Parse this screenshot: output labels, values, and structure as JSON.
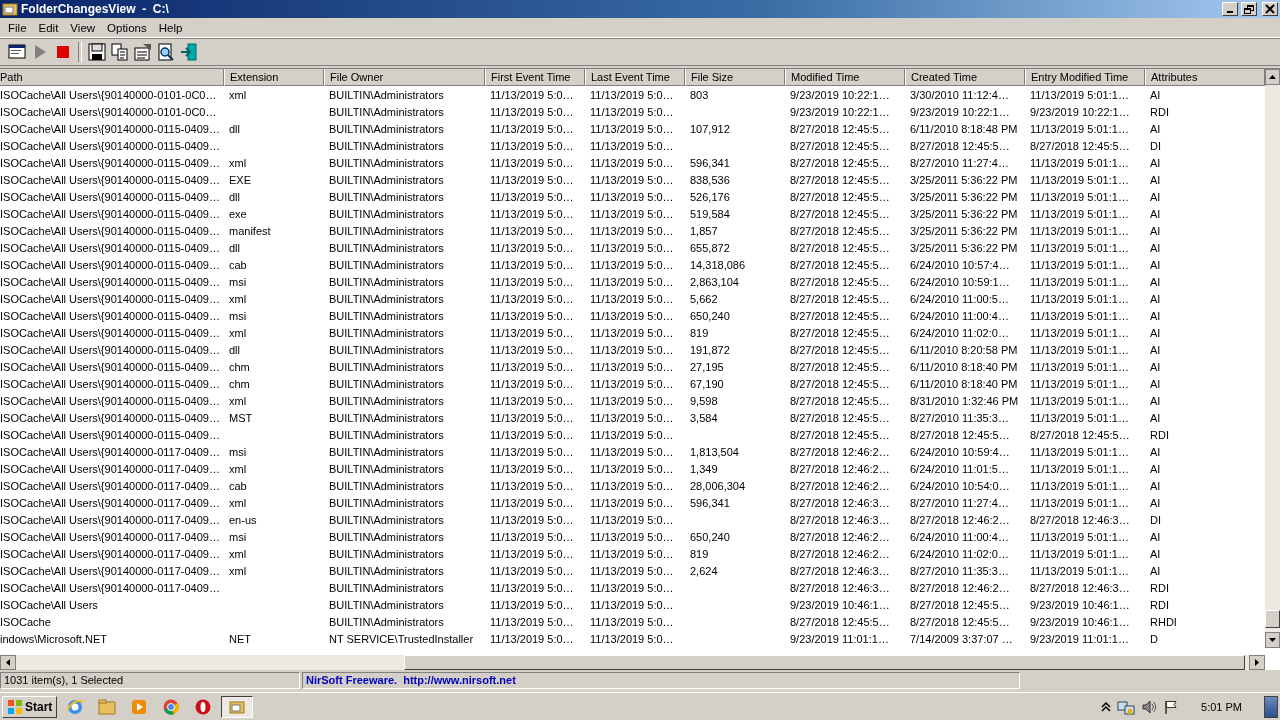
{
  "window": {
    "title": "FolderChangesView  -  C:\\"
  },
  "menu": [
    "File",
    "Edit",
    "View",
    "Options",
    "Help"
  ],
  "table": {
    "columns": [
      "Path",
      "Extension",
      "File Owner",
      "First Event Time",
      "Last Event Time",
      "File Size",
      "Modified Time",
      "Created Time",
      "Entry Modified Time",
      "Attributes"
    ],
    "rows": [
      {
        "path": "ISOCache\\All Users\\{90140000-0101-0C0…",
        "extension": "xml",
        "file_owner": "BUILTIN\\Administrators",
        "first_event_time": "11/13/2019 5:0…",
        "last_event_time": "11/13/2019 5:0…",
        "file_size": "803",
        "modified_time": "9/23/2019 10:22:1…",
        "created_time": "3/30/2010 11:12:4…",
        "entry_modified_time": "11/13/2019 5:01:1…",
        "attributes": "AI"
      },
      {
        "path": "ISOCache\\All Users\\{90140000-0101-0C0…",
        "file_owner": "BUILTIN\\Administrators",
        "first_event_time": "11/13/2019 5:0…",
        "last_event_time": "11/13/2019 5:0…",
        "modified_time": "9/23/2019 10:22:1…",
        "created_time": "9/23/2019 10:22:1…",
        "entry_modified_time": "9/23/2019 10:22:1…",
        "attributes": "RDI"
      },
      {
        "path": "ISOCache\\All Users\\{90140000-0115-0409…",
        "extension": "dll",
        "file_owner": "BUILTIN\\Administrators",
        "first_event_time": "11/13/2019 5:0…",
        "last_event_time": "11/13/2019 5:0…",
        "file_size": "107,912",
        "modified_time": "8/27/2018 12:45:5…",
        "created_time": "6/11/2010 8:18:48 PM",
        "entry_modified_time": "11/13/2019 5:01:1…",
        "attributes": "AI"
      },
      {
        "path": "ISOCache\\All Users\\{90140000-0115-0409…",
        "file_owner": "BUILTIN\\Administrators",
        "first_event_time": "11/13/2019 5:0…",
        "last_event_time": "11/13/2019 5:0…",
        "modified_time": "8/27/2018 12:45:5…",
        "created_time": "8/27/2018 12:45:5…",
        "entry_modified_time": "8/27/2018 12:45:5…",
        "attributes": "DI"
      },
      {
        "path": "ISOCache\\All Users\\{90140000-0115-0409…",
        "extension": "xml",
        "file_owner": "BUILTIN\\Administrators",
        "first_event_time": "11/13/2019 5:0…",
        "last_event_time": "11/13/2019 5:0…",
        "file_size": "596,341",
        "modified_time": "8/27/2018 12:45:5…",
        "created_time": "8/27/2010 11:27:4…",
        "entry_modified_time": "11/13/2019 5:01:1…",
        "attributes": "AI"
      },
      {
        "path": "ISOCache\\All Users\\{90140000-0115-0409…",
        "extension": "EXE",
        "file_owner": "BUILTIN\\Administrators",
        "first_event_time": "11/13/2019 5:0…",
        "last_event_time": "11/13/2019 5:0…",
        "file_size": "838,536",
        "modified_time": "8/27/2018 12:45:5…",
        "created_time": "3/25/2011 5:36:22 PM",
        "entry_modified_time": "11/13/2019 5:01:1…",
        "attributes": "AI"
      },
      {
        "path": "ISOCache\\All Users\\{90140000-0115-0409…",
        "extension": "dll",
        "file_owner": "BUILTIN\\Administrators",
        "first_event_time": "11/13/2019 5:0…",
        "last_event_time": "11/13/2019 5:0…",
        "file_size": "526,176",
        "modified_time": "8/27/2018 12:45:5…",
        "created_time": "3/25/2011 5:36:22 PM",
        "entry_modified_time": "11/13/2019 5:01:1…",
        "attributes": "AI"
      },
      {
        "path": "ISOCache\\All Users\\{90140000-0115-0409…",
        "extension": "exe",
        "file_owner": "BUILTIN\\Administrators",
        "first_event_time": "11/13/2019 5:0…",
        "last_event_time": "11/13/2019 5:0…",
        "file_size": "519,584",
        "modified_time": "8/27/2018 12:45:5…",
        "created_time": "3/25/2011 5:36:22 PM",
        "entry_modified_time": "11/13/2019 5:01:1…",
        "attributes": "AI"
      },
      {
        "path": "ISOCache\\All Users\\{90140000-0115-0409…",
        "extension": "manifest",
        "file_owner": "BUILTIN\\Administrators",
        "first_event_time": "11/13/2019 5:0…",
        "last_event_time": "11/13/2019 5:0…",
        "file_size": "1,857",
        "modified_time": "8/27/2018 12:45:5…",
        "created_time": "3/25/2011 5:36:22 PM",
        "entry_modified_time": "11/13/2019 5:01:1…",
        "attributes": "AI"
      },
      {
        "path": "ISOCache\\All Users\\{90140000-0115-0409…",
        "extension": "dll",
        "file_owner": "BUILTIN\\Administrators",
        "first_event_time": "11/13/2019 5:0…",
        "last_event_time": "11/13/2019 5:0…",
        "file_size": "655,872",
        "modified_time": "8/27/2018 12:45:5…",
        "created_time": "3/25/2011 5:36:22 PM",
        "entry_modified_time": "11/13/2019 5:01:1…",
        "attributes": "AI"
      },
      {
        "path": "ISOCache\\All Users\\{90140000-0115-0409…",
        "extension": "cab",
        "file_owner": "BUILTIN\\Administrators",
        "first_event_time": "11/13/2019 5:0…",
        "last_event_time": "11/13/2019 5:0…",
        "file_size": "14,318,086",
        "modified_time": "8/27/2018 12:45:5…",
        "created_time": "6/24/2010 10:57:4…",
        "entry_modified_time": "11/13/2019 5:01:1…",
        "attributes": "AI"
      },
      {
        "path": "ISOCache\\All Users\\{90140000-0115-0409…",
        "extension": "msi",
        "file_owner": "BUILTIN\\Administrators",
        "first_event_time": "11/13/2019 5:0…",
        "last_event_time": "11/13/2019 5:0…",
        "file_size": "2,863,104",
        "modified_time": "8/27/2018 12:45:5…",
        "created_time": "6/24/2010 10:59:1…",
        "entry_modified_time": "11/13/2019 5:01:1…",
        "attributes": "AI"
      },
      {
        "path": "ISOCache\\All Users\\{90140000-0115-0409…",
        "extension": "xml",
        "file_owner": "BUILTIN\\Administrators",
        "first_event_time": "11/13/2019 5:0…",
        "last_event_time": "11/13/2019 5:0…",
        "file_size": "5,662",
        "modified_time": "8/27/2018 12:45:5…",
        "created_time": "6/24/2010 11:00:5…",
        "entry_modified_time": "11/13/2019 5:01:1…",
        "attributes": "AI"
      },
      {
        "path": "ISOCache\\All Users\\{90140000-0115-0409…",
        "extension": "msi",
        "file_owner": "BUILTIN\\Administrators",
        "first_event_time": "11/13/2019 5:0…",
        "last_event_time": "11/13/2019 5:0…",
        "file_size": "650,240",
        "modified_time": "8/27/2018 12:45:5…",
        "created_time": "6/24/2010 11:00:4…",
        "entry_modified_time": "11/13/2019 5:01:1…",
        "attributes": "AI"
      },
      {
        "path": "ISOCache\\All Users\\{90140000-0115-0409…",
        "extension": "xml",
        "file_owner": "BUILTIN\\Administrators",
        "first_event_time": "11/13/2019 5:0…",
        "last_event_time": "11/13/2019 5:0…",
        "file_size": "819",
        "modified_time": "8/27/2018 12:45:5…",
        "created_time": "6/24/2010 11:02:0…",
        "entry_modified_time": "11/13/2019 5:01:1…",
        "attributes": "AI"
      },
      {
        "path": "ISOCache\\All Users\\{90140000-0115-0409…",
        "extension": "dll",
        "file_owner": "BUILTIN\\Administrators",
        "first_event_time": "11/13/2019 5:0…",
        "last_event_time": "11/13/2019 5:0…",
        "file_size": "191,872",
        "modified_time": "8/27/2018 12:45:5…",
        "created_time": "6/11/2010 8:20:58 PM",
        "entry_modified_time": "11/13/2019 5:01:1…",
        "attributes": "AI"
      },
      {
        "path": "ISOCache\\All Users\\{90140000-0115-0409…",
        "extension": "chm",
        "file_owner": "BUILTIN\\Administrators",
        "first_event_time": "11/13/2019 5:0…",
        "last_event_time": "11/13/2019 5:0…",
        "file_size": "27,195",
        "modified_time": "8/27/2018 12:45:5…",
        "created_time": "6/11/2010 8:18:40 PM",
        "entry_modified_time": "11/13/2019 5:01:1…",
        "attributes": "AI"
      },
      {
        "path": "ISOCache\\All Users\\{90140000-0115-0409…",
        "extension": "chm",
        "file_owner": "BUILTIN\\Administrators",
        "first_event_time": "11/13/2019 5:0…",
        "last_event_time": "11/13/2019 5:0…",
        "file_size": "67,190",
        "modified_time": "8/27/2018 12:45:5…",
        "created_time": "6/11/2010 8:18:40 PM",
        "entry_modified_time": "11/13/2019 5:01:1…",
        "attributes": "AI"
      },
      {
        "path": "ISOCache\\All Users\\{90140000-0115-0409…",
        "extension": "xml",
        "file_owner": "BUILTIN\\Administrators",
        "first_event_time": "11/13/2019 5:0…",
        "last_event_time": "11/13/2019 5:0…",
        "file_size": "9,598",
        "modified_time": "8/27/2018 12:45:5…",
        "created_time": "8/31/2010 1:32:46 PM",
        "entry_modified_time": "11/13/2019 5:01:1…",
        "attributes": "AI"
      },
      {
        "path": "ISOCache\\All Users\\{90140000-0115-0409…",
        "extension": "MST",
        "file_owner": "BUILTIN\\Administrators",
        "first_event_time": "11/13/2019 5:0…",
        "last_event_time": "11/13/2019 5:0…",
        "file_size": "3,584",
        "modified_time": "8/27/2018 12:45:5…",
        "created_time": "8/27/2010 11:35:3…",
        "entry_modified_time": "11/13/2019 5:01:1…",
        "attributes": "AI"
      },
      {
        "path": "ISOCache\\All Users\\{90140000-0115-0409…",
        "file_owner": "BUILTIN\\Administrators",
        "first_event_time": "11/13/2019 5:0…",
        "last_event_time": "11/13/2019 5:0…",
        "modified_time": "8/27/2018 12:45:5…",
        "created_time": "8/27/2018 12:45:5…",
        "entry_modified_time": "8/27/2018 12:45:5…",
        "attributes": "RDI"
      },
      {
        "path": "ISOCache\\All Users\\{90140000-0117-0409…",
        "extension": "msi",
        "file_owner": "BUILTIN\\Administrators",
        "first_event_time": "11/13/2019 5:0…",
        "last_event_time": "11/13/2019 5:0…",
        "file_size": "1,813,504",
        "modified_time": "8/27/2018 12:46:2…",
        "created_time": "6/24/2010 10:59:4…",
        "entry_modified_time": "11/13/2019 5:01:1…",
        "attributes": "AI"
      },
      {
        "path": "ISOCache\\All Users\\{90140000-0117-0409…",
        "extension": "xml",
        "file_owner": "BUILTIN\\Administrators",
        "first_event_time": "11/13/2019 5:0…",
        "last_event_time": "11/13/2019 5:0…",
        "file_size": "1,349",
        "modified_time": "8/27/2018 12:46:2…",
        "created_time": "6/24/2010 11:01:5…",
        "entry_modified_time": "11/13/2019 5:01:1…",
        "attributes": "AI"
      },
      {
        "path": "ISOCache\\All Users\\{90140000-0117-0409…",
        "extension": "cab",
        "file_owner": "BUILTIN\\Administrators",
        "first_event_time": "11/13/2019 5:0…",
        "last_event_time": "11/13/2019 5:0…",
        "file_size": "28,006,304",
        "modified_time": "8/27/2018 12:46:2…",
        "created_time": "6/24/2010 10:54:0…",
        "entry_modified_time": "11/13/2019 5:01:1…",
        "attributes": "AI"
      },
      {
        "path": "ISOCache\\All Users\\{90140000-0117-0409…",
        "extension": "xml",
        "file_owner": "BUILTIN\\Administrators",
        "first_event_time": "11/13/2019 5:0…",
        "last_event_time": "11/13/2019 5:0…",
        "file_size": "596,341",
        "modified_time": "8/27/2018 12:46:3…",
        "created_time": "8/27/2010 11:27:4…",
        "entry_modified_time": "11/13/2019 5:01:1…",
        "attributes": "AI"
      },
      {
        "path": "ISOCache\\All Users\\{90140000-0117-0409…",
        "extension": "en-us",
        "file_owner": "BUILTIN\\Administrators",
        "first_event_time": "11/13/2019 5:0…",
        "last_event_time": "11/13/2019 5:0…",
        "modified_time": "8/27/2018 12:46:3…",
        "created_time": "8/27/2018 12:46:2…",
        "entry_modified_time": "8/27/2018 12:46:3…",
        "attributes": "DI"
      },
      {
        "path": "ISOCache\\All Users\\{90140000-0117-0409…",
        "extension": "msi",
        "file_owner": "BUILTIN\\Administrators",
        "first_event_time": "11/13/2019 5:0…",
        "last_event_time": "11/13/2019 5:0…",
        "file_size": "650,240",
        "modified_time": "8/27/2018 12:46:2…",
        "created_time": "6/24/2010 11:00:4…",
        "entry_modified_time": "11/13/2019 5:01:1…",
        "attributes": "AI"
      },
      {
        "path": "ISOCache\\All Users\\{90140000-0117-0409…",
        "extension": "xml",
        "file_owner": "BUILTIN\\Administrators",
        "first_event_time": "11/13/2019 5:0…",
        "last_event_time": "11/13/2019 5:0…",
        "file_size": "819",
        "modified_time": "8/27/2018 12:46:2…",
        "created_time": "6/24/2010 11:02:0…",
        "entry_modified_time": "11/13/2019 5:01:1…",
        "attributes": "AI"
      },
      {
        "path": "ISOCache\\All Users\\{90140000-0117-0409…",
        "extension": "xml",
        "file_owner": "BUILTIN\\Administrators",
        "first_event_time": "11/13/2019 5:0…",
        "last_event_time": "11/13/2019 5:0…",
        "file_size": "2,624",
        "modified_time": "8/27/2018 12:46:3…",
        "created_time": "8/27/2010 11:35:3…",
        "entry_modified_time": "11/13/2019 5:01:1…",
        "attributes": "AI"
      },
      {
        "path": "ISOCache\\All Users\\{90140000-0117-0409…",
        "file_owner": "BUILTIN\\Administrators",
        "first_event_time": "11/13/2019 5:0…",
        "last_event_time": "11/13/2019 5:0…",
        "modified_time": "8/27/2018 12:46:3…",
        "created_time": "8/27/2018 12:46:2…",
        "entry_modified_time": "8/27/2018 12:46:3…",
        "attributes": "RDI"
      },
      {
        "path": "ISOCache\\All Users",
        "file_owner": "BUILTIN\\Administrators",
        "first_event_time": "11/13/2019 5:0…",
        "last_event_time": "11/13/2019 5:0…",
        "modified_time": "9/23/2019 10:46:1…",
        "created_time": "8/27/2018 12:45:5…",
        "entry_modified_time": "9/23/2019 10:46:1…",
        "attributes": "RDI"
      },
      {
        "path": "ISOCache",
        "file_owner": "BUILTIN\\Administrators",
        "first_event_time": "11/13/2019 5:0…",
        "last_event_time": "11/13/2019 5:0…",
        "modified_time": "8/27/2018 12:45:5…",
        "created_time": "8/27/2018 12:45:5…",
        "entry_modified_time": "9/23/2019 10:46:1…",
        "attributes": "RHDI"
      },
      {
        "path": "indows\\Microsoft.NET",
        "extension": "NET",
        "file_owner": "NT SERVICE\\TrustedInstaller",
        "first_event_time": "11/13/2019 5:0…",
        "last_event_time": "11/13/2019 5:0…",
        "modified_time": "9/23/2019 11:01:1…",
        "created_time": "7/14/2009 3:37:07 …",
        "entry_modified_time": "9/23/2019 11:01:1…",
        "attributes": "D"
      }
    ]
  },
  "status_bar": {
    "items_count": "1031 item(s), 1 Selected",
    "credit": "NirSoft Freeware.  http://www.nirsoft.net"
  },
  "taskbar": {
    "start_label": "Start",
    "clock": "5:01 PM"
  }
}
